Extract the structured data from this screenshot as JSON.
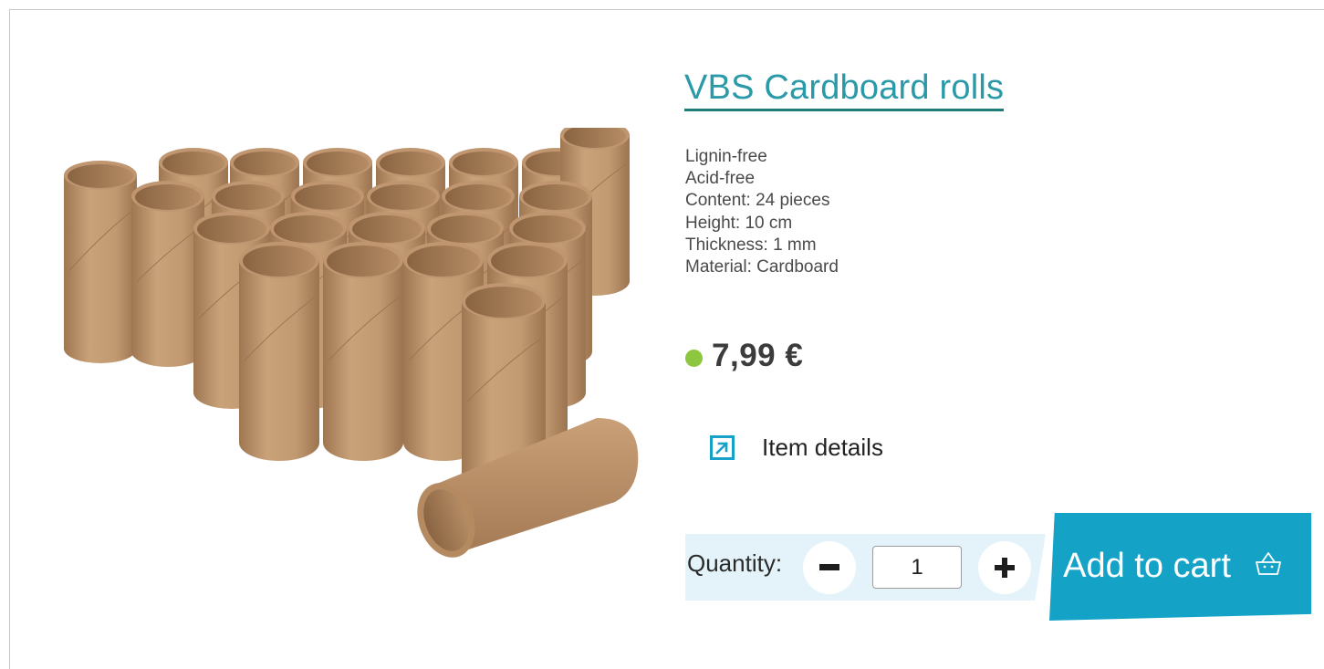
{
  "product": {
    "title": "VBS Cardboard rolls",
    "image_alt": "cardboard-rolls-photo",
    "features": [
      "Lignin-free",
      "Acid-free",
      "Content: 24 pieces",
      "Height: 10 cm",
      "Thickness: 1 mm",
      "Material: Cardboard"
    ],
    "price": "7,99 €",
    "stock_status_color": "#8dc63f"
  },
  "links": {
    "details_label": "Item details",
    "details_icon": "external-link-icon"
  },
  "quantity": {
    "label": "Quantity:",
    "value": "1",
    "minus_icon": "minus-icon",
    "plus_icon": "plus-icon"
  },
  "cart": {
    "add_label": "Add to cart",
    "icon": "basket-icon",
    "button_color": "#14a3c7"
  },
  "colors": {
    "title": "#2b9aa8",
    "title_underline": "#1f7d78",
    "accent": "#16a1c9",
    "quantity_band": "#e3f3f9"
  }
}
